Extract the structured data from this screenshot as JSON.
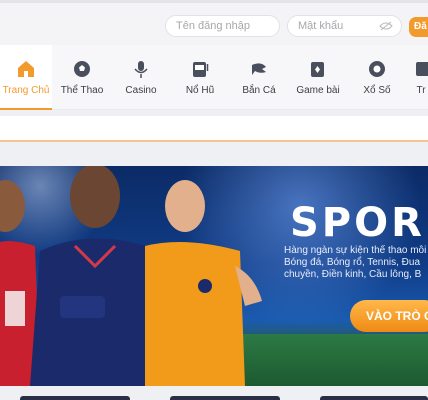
{
  "login": {
    "username_placeholder": "Tên đăng nhập",
    "password_placeholder": "Mật khẩu",
    "login_button": "Đă"
  },
  "nav": {
    "items": [
      {
        "label": "Trang Chủ",
        "icon": "home-icon",
        "active": true
      },
      {
        "label": "Thể Thao",
        "icon": "soccer-ball-icon"
      },
      {
        "label": "Casino",
        "icon": "microphone-icon"
      },
      {
        "label": "Nổ Hũ",
        "icon": "slot-machine-icon"
      },
      {
        "label": "Bắn Cá",
        "icon": "fish-icon"
      },
      {
        "label": "Game bài",
        "icon": "cards-icon"
      },
      {
        "label": "Xổ Số",
        "icon": "lottery-ball-icon"
      },
      {
        "label": "Tr",
        "icon": "more-icon"
      }
    ]
  },
  "banner": {
    "title": "SPOR",
    "desc_lines": [
      "Hàng ngàn sự kiện thể thao mỗi",
      "Bóng đá, Bóng rổ, Tennis, Đua",
      "chuyền, Điền kinh, Cầu lông, B"
    ],
    "cta": "VÀO TRÒ C"
  },
  "colors": {
    "accent": "#f39a2c",
    "banner_blue": "#103c86"
  }
}
